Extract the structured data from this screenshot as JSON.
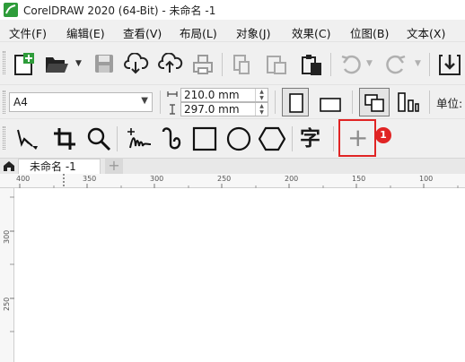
{
  "window": {
    "title": "CorelDRAW 2020 (64-Bit) - 未命名 -1"
  },
  "menu": [
    {
      "label": "文件(F)"
    },
    {
      "label": "编辑(E)"
    },
    {
      "label": "查看(V)"
    },
    {
      "label": "布局(L)"
    },
    {
      "label": "对象(J)"
    },
    {
      "label": "效果(C)"
    },
    {
      "label": "位图(B)"
    },
    {
      "label": "文本(X)"
    }
  ],
  "toolbar_icons": [
    "new-document-icon",
    "open-folder-icon",
    "save-icon",
    "cloud-download-icon",
    "cloud-upload-icon",
    "print-icon",
    "copy-icon",
    "paste-icon",
    "clipboard-icon",
    "undo-icon",
    "redo-icon",
    "import-icon"
  ],
  "property_bar": {
    "page_size": "A4",
    "width": "210.0 mm",
    "height": "297.0 mm",
    "units_label": "单位:"
  },
  "toolbox_icons": [
    "pick-tool-icon",
    "crop-tool-icon",
    "zoom-tool-icon",
    "freehand-tool-icon",
    "artistic-media-icon",
    "rectangle-tool-icon",
    "ellipse-tool-icon",
    "polygon-tool-icon",
    "text-tool-icon",
    "add-tool-icon"
  ],
  "toolbox": {
    "text_tool_glyph": "字",
    "add_tool_glyph": "+"
  },
  "annotation": {
    "badge": "1",
    "color": "#e02424"
  },
  "tabs": {
    "document": "未命名 -1",
    "add": "+"
  },
  "ruler": {
    "horizontal": [
      "400",
      "350",
      "300",
      "250",
      "200",
      "150",
      "100"
    ],
    "vertical": [
      "300",
      "250"
    ]
  }
}
